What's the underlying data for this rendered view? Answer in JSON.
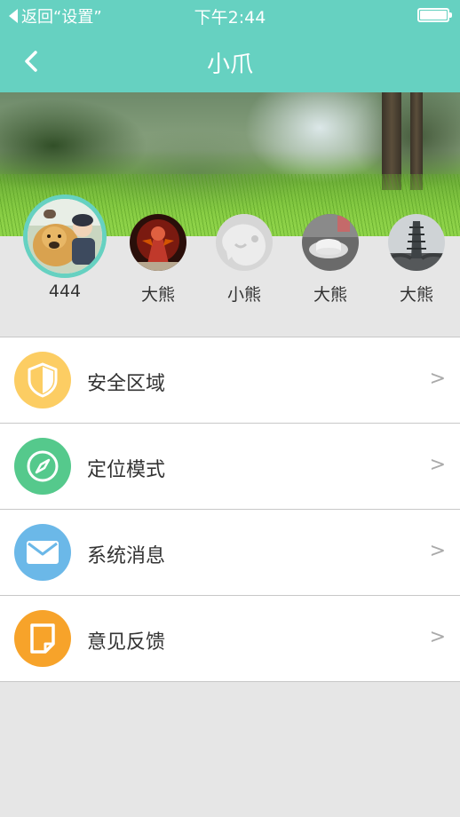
{
  "status_bar": {
    "back_label": "返回“设置”",
    "time": "下午2:44"
  },
  "nav": {
    "title": "小爪",
    "back_icon": "chevron-left-icon"
  },
  "devices": [
    {
      "name": "444",
      "selected": true,
      "icon": "dog-and-child-photo"
    },
    {
      "name": "大熊",
      "selected": false,
      "icon": "red-figure-photo"
    },
    {
      "name": "小熊",
      "selected": false,
      "icon": "default-avatar-icon"
    },
    {
      "name": "大熊",
      "selected": false,
      "icon": "cup-photo"
    },
    {
      "name": "大熊",
      "selected": false,
      "icon": "pagoda-photo"
    }
  ],
  "menu": [
    {
      "label": "安全区域",
      "icon": "shield-icon",
      "color": "#fccd63"
    },
    {
      "label": "定位模式",
      "icon": "compass-icon",
      "color": "#55c98c"
    },
    {
      "label": "系统消息",
      "icon": "envelope-icon",
      "color": "#6bb8e8"
    },
    {
      "label": "意见反馈",
      "icon": "feedback-note-icon",
      "color": "#f7a32a"
    }
  ],
  "chevron": ">",
  "colors": {
    "accent": "#66d1c1",
    "background": "#e6e6e6"
  }
}
